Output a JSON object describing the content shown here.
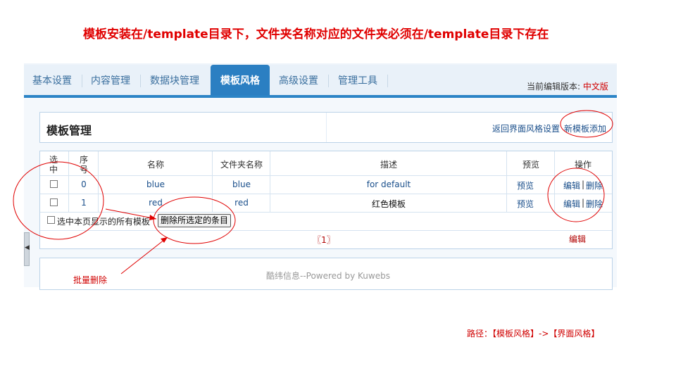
{
  "banner": "模板安装在/template目录下，文件夹名称对应的文件夹必须在/template目录下存在",
  "tabs": [
    {
      "label": "基本设置"
    },
    {
      "label": "内容管理"
    },
    {
      "label": "数据块管理"
    },
    {
      "label": "模板风格",
      "active": true
    },
    {
      "label": "高级设置"
    },
    {
      "label": "管理工具"
    }
  ],
  "version": {
    "label": "当前编辑版本:",
    "lang": "中文版"
  },
  "panel": {
    "title": "模板管理",
    "back_link": "返回界面风格设置",
    "new_link": "新模板添加"
  },
  "table": {
    "headers": {
      "select_1": "选",
      "select_2": "中",
      "index_1": "序",
      "index_2": "号",
      "name": "名称",
      "folder": "文件夹名称",
      "desc": "描述",
      "preview": "预览",
      "ops": "操作"
    },
    "rows": [
      {
        "index": "0",
        "name": "blue",
        "folder": "blue",
        "desc": "for default",
        "preview": "预览",
        "edit": "编辑",
        "sep": "|",
        "delete": "删除"
      },
      {
        "index": "1",
        "name": "red",
        "folder": "red",
        "desc": "红色模板",
        "preview": "预览",
        "edit": "编辑",
        "sep": "|",
        "delete": "删除"
      }
    ],
    "select_all_label": "选中本页显示的所有模板",
    "delete_selected": "删除所选定的条目",
    "pager": "〖1〗",
    "edit_bottom": "编辑"
  },
  "footer": "酷纬信息--Powered by Kuwebs",
  "annotations": {
    "batch_delete": "批量删除",
    "path": "路径：【模板风格】->【界面风格】",
    "color": "#e00000"
  }
}
